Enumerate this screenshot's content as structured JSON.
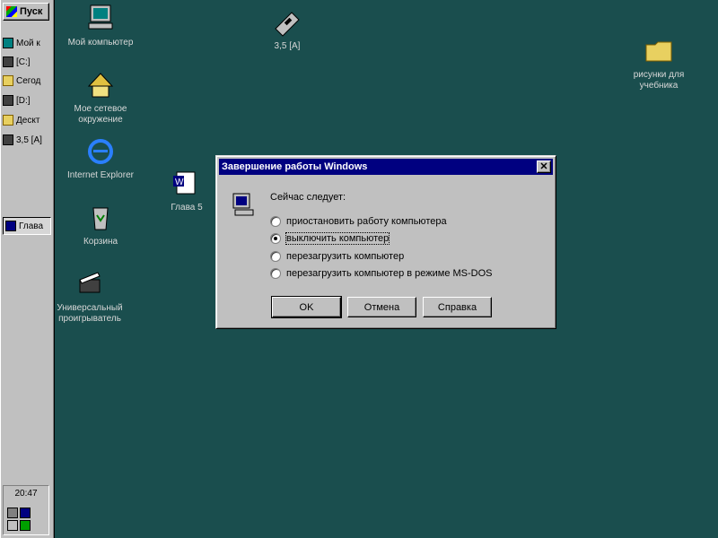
{
  "taskbar": {
    "start_label": "Пуск",
    "quick": [
      {
        "label": "Мой к",
        "icon": "window-icon"
      },
      {
        "label": "[C:]",
        "icon": "drive-icon"
      },
      {
        "label": "Сегод",
        "icon": "folder-icon"
      },
      {
        "label": "[D:]",
        "icon": "drive-icon"
      },
      {
        "label": "Дескт",
        "icon": "folder-icon"
      },
      {
        "label": "3,5 [A]",
        "icon": "floppy-icon"
      }
    ],
    "active_task": "Глава",
    "clock": "20:47"
  },
  "desktop_icons": [
    {
      "label": "Мой компьютер",
      "icon": "my-computer-icon"
    },
    {
      "label": "Мое сетевое окружение",
      "icon": "network-icon"
    },
    {
      "label": "Internet Explorer",
      "icon": "internet-explorer-icon"
    },
    {
      "label": "Корзина",
      "icon": "recycle-bin-icon"
    },
    {
      "label": "Универсальный проигрыватель",
      "icon": "media-player-icon"
    },
    {
      "label": "3,5 [A]",
      "icon": "floppy-drive-icon"
    },
    {
      "label": "Глава 5",
      "icon": "word-document-icon"
    },
    {
      "label": "рисунки для учебника",
      "icon": "folder-icon"
    }
  ],
  "dialog": {
    "title": "Завершение работы Windows",
    "prompt": "Сейчас следует:",
    "options": [
      {
        "label": "приостановить работу компьютера",
        "checked": false
      },
      {
        "label": "выключить компьютер",
        "checked": true
      },
      {
        "label": "перезагрузить компьютер",
        "checked": false
      },
      {
        "label": "перезагрузить компьютер в режиме MS-DOS",
        "checked": false
      }
    ],
    "buttons": {
      "ok": "OK",
      "cancel": "Отмена",
      "help": "Справка"
    }
  },
  "colors": {
    "desktop": "#1e5a5a",
    "titlebar": "#000080",
    "face": "#c0c0c0"
  }
}
